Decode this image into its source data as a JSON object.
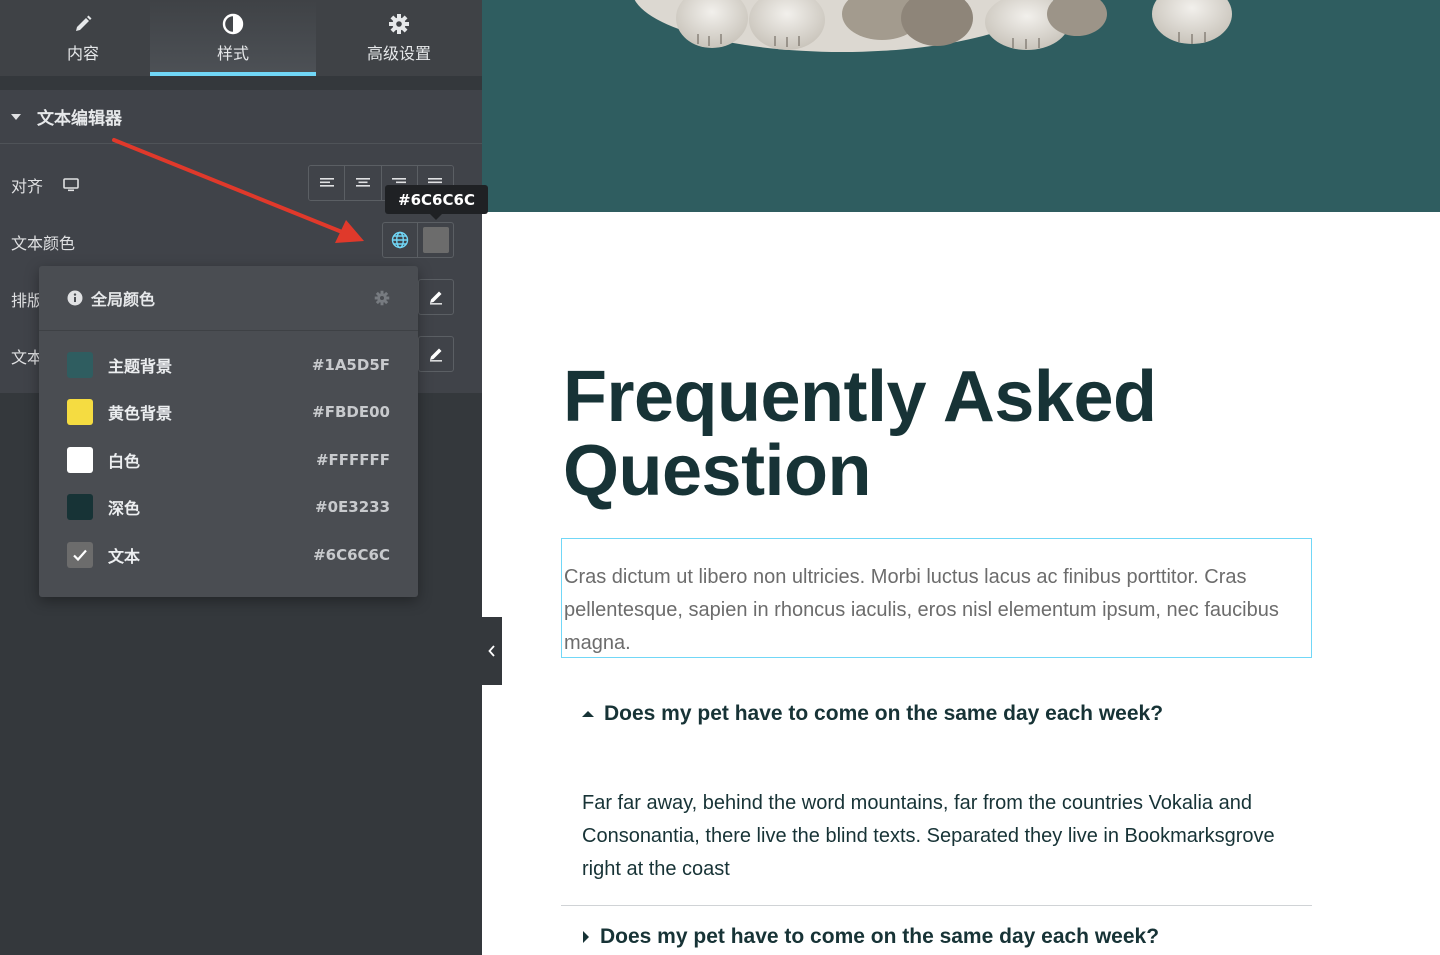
{
  "tabs": [
    {
      "label": "内容",
      "icon": "pencil-icon"
    },
    {
      "label": "样式",
      "icon": "contrast-icon"
    },
    {
      "label": "高级设置",
      "icon": "gear-icon"
    }
  ],
  "active_tab": "样式",
  "section": {
    "title": "文本编辑器"
  },
  "controls": {
    "align_label": "对齐",
    "text_color_label": "文本颜色",
    "typography_label": "排版",
    "text_shadow_label": "文本"
  },
  "current_color": {
    "hex": "#6C6C6C",
    "tooltip": "#6C6C6C"
  },
  "global_colors": {
    "title": "全局颜色",
    "items": [
      {
        "name": "主题背景",
        "hex": "#1A5D5F",
        "color": "#2f5d60"
      },
      {
        "name": "黄色背景",
        "hex": "#FBDE00",
        "color": "#f5dc41"
      },
      {
        "name": "白色",
        "hex": "#FFFFFF",
        "color": "#ffffff"
      },
      {
        "name": "深色",
        "hex": "#0E3233",
        "color": "#173336"
      },
      {
        "name": "文本",
        "hex": "#6C6C6C",
        "color": "#6c6c6c",
        "selected": true
      }
    ]
  },
  "preview": {
    "heading": "Frequently Asked Question",
    "intro": "Cras dictum ut libero non ultricies. Morbi luctus lacus ac finibus porttitor. Cras pellentesque, sapien in rhoncus iaculis, eros nisl elementum ipsum, nec faucibus magna.",
    "faq": [
      {
        "question": "Does my pet have to come on the same day each week?",
        "answer": "Far far away, behind the word mountains, far from the countries Vokalia and Consonantia, there live the blind texts. Separated they live in Bookmarksgrove right at the coast",
        "expanded": true
      },
      {
        "question": "Does my pet have to come on the same day each week?",
        "expanded": false
      }
    ]
  }
}
